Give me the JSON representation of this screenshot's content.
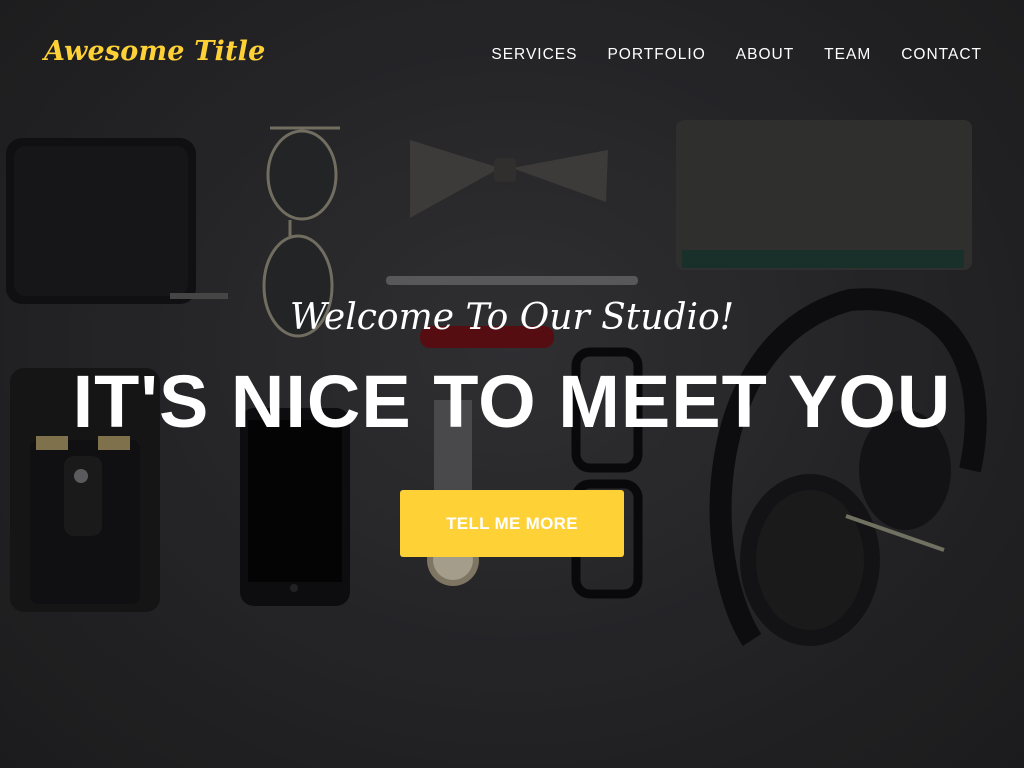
{
  "header": {
    "brand": "Awesome Title",
    "nav": [
      {
        "label": "SERVICES"
      },
      {
        "label": "PORTFOLIO"
      },
      {
        "label": "ABOUT"
      },
      {
        "label": "TEAM"
      },
      {
        "label": "CONTACT"
      }
    ]
  },
  "hero": {
    "subheading": "Welcome To Our Studio!",
    "heading": "IT'S NICE TO MEET YOU",
    "cta_label": "TELL ME MORE"
  },
  "colors": {
    "accent": "#fed136",
    "text": "#ffffff",
    "background": "#2c2c2f"
  }
}
